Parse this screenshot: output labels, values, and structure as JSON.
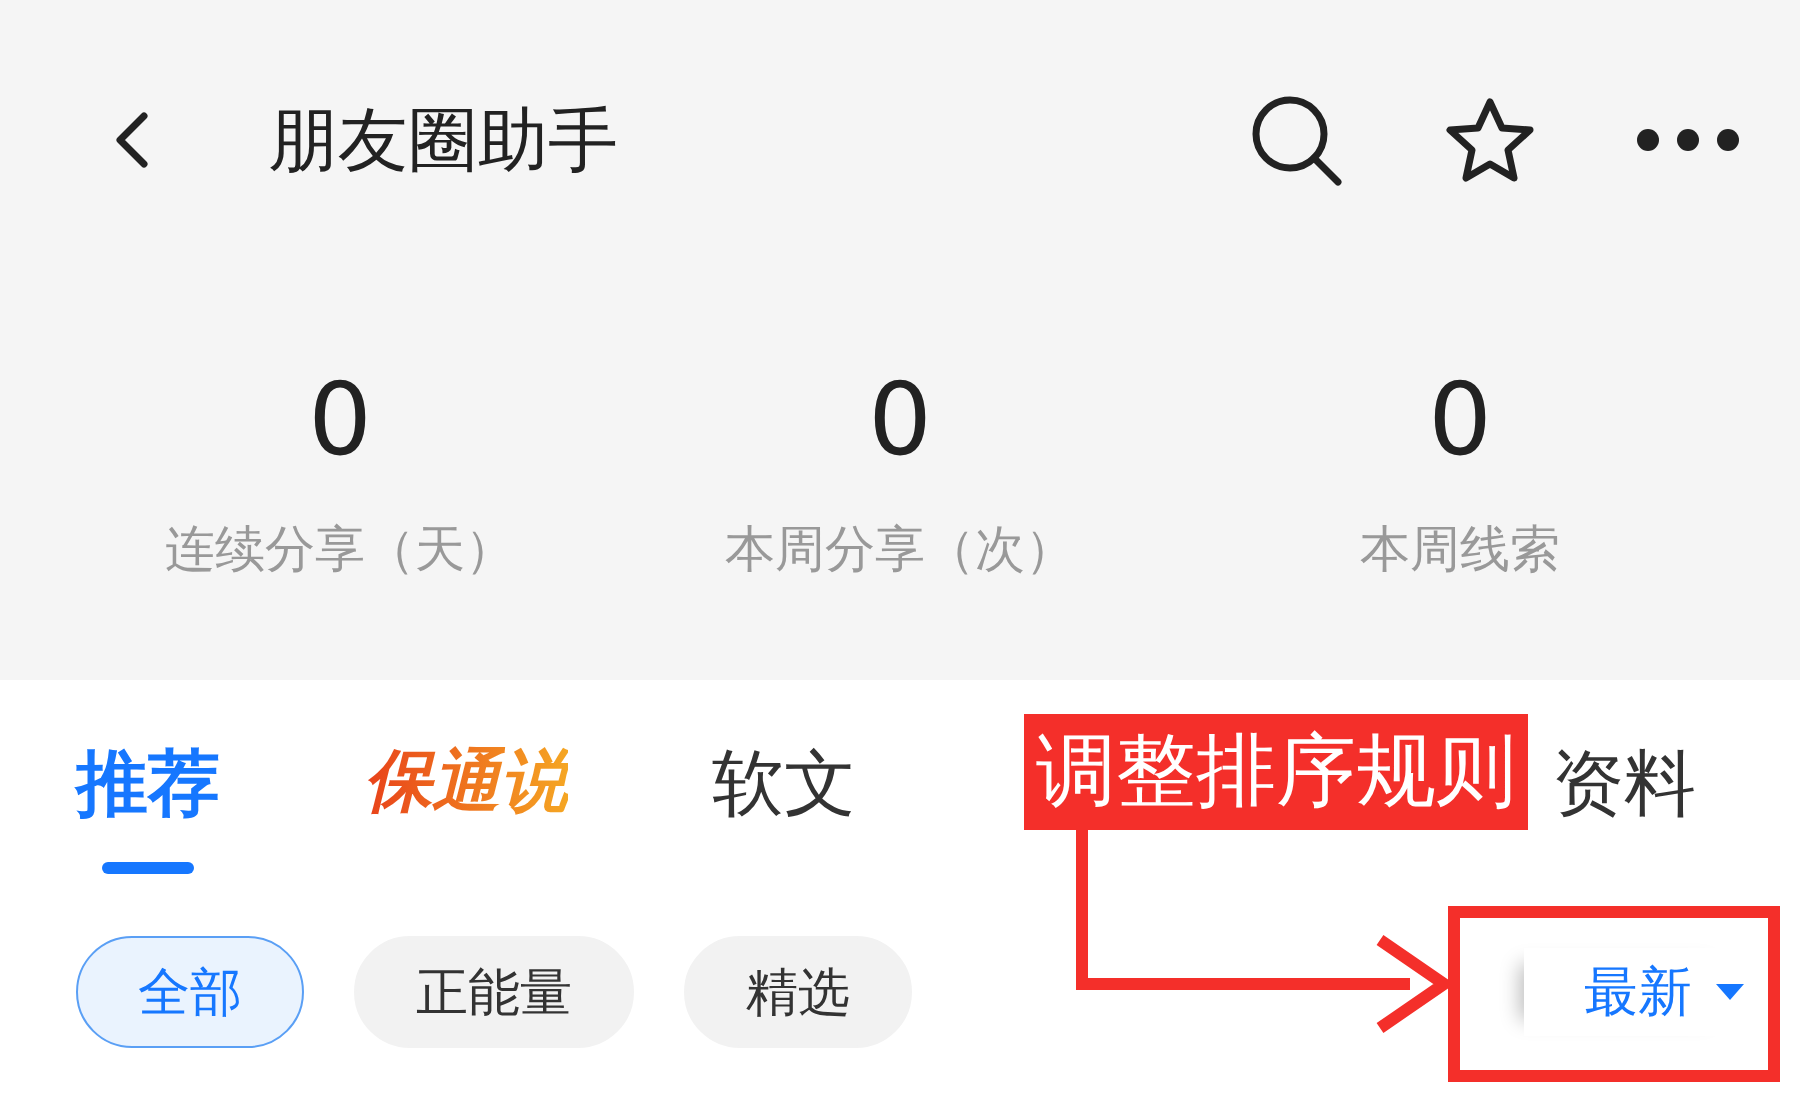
{
  "header": {
    "title": "朋友圈助手"
  },
  "stats": [
    {
      "value": "0",
      "label": "连续分享（天）"
    },
    {
      "value": "0",
      "label": "本周分享（次）"
    },
    {
      "value": "0",
      "label": "本周线索"
    }
  ],
  "tabs": [
    {
      "label": "推荐",
      "kind": "text",
      "selected": true
    },
    {
      "label": "保通说",
      "kind": "logo",
      "selected": false
    },
    {
      "label": "软文",
      "kind": "text",
      "selected": false
    },
    {
      "label": "资料",
      "kind": "text",
      "selected": false
    }
  ],
  "filters": [
    {
      "label": "全部",
      "selected": true
    },
    {
      "label": "正能量",
      "selected": false
    },
    {
      "label": "精选",
      "selected": false
    }
  ],
  "sort": {
    "label": "最新"
  },
  "annotation": {
    "text": "调整排序规则"
  }
}
